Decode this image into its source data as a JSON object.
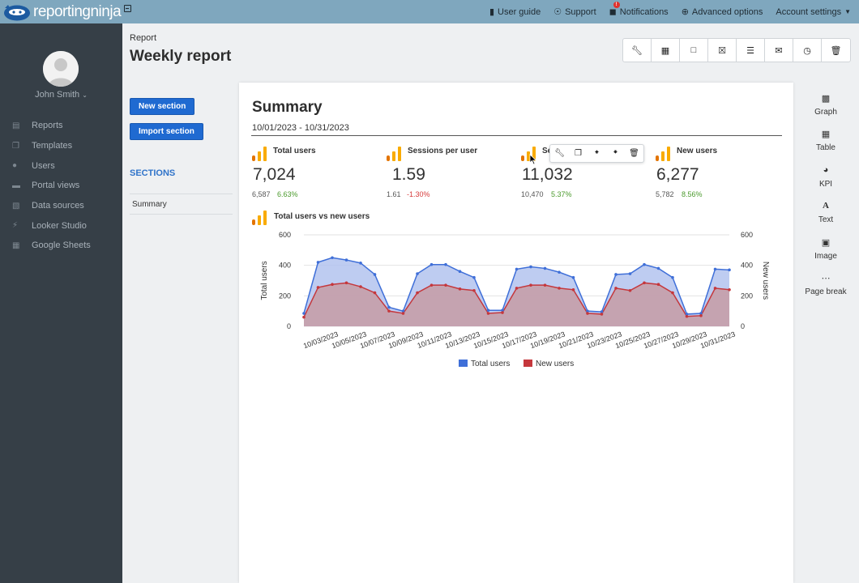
{
  "topbar": {
    "logo_text": "reportingninja",
    "nav": [
      {
        "icon": "book-icon",
        "label": "User guide"
      },
      {
        "icon": "lifebuoy-icon",
        "label": "Support"
      },
      {
        "icon": "bell-icon",
        "label": "Notifications",
        "badge": "!"
      },
      {
        "icon": "plus-circle-icon",
        "label": "Advanced options"
      },
      {
        "icon": "",
        "label": "Account settings"
      }
    ]
  },
  "sidebar": {
    "username": "John Smith",
    "items": [
      {
        "icon": "file-icon",
        "label": "Reports"
      },
      {
        "icon": "copy-icon",
        "label": "Templates"
      },
      {
        "icon": "user-icon",
        "label": "Users"
      },
      {
        "icon": "folder-icon",
        "label": "Portal views"
      },
      {
        "icon": "database-icon",
        "label": "Data sources"
      },
      {
        "icon": "plug-icon",
        "label": "Looker Studio"
      },
      {
        "icon": "table-icon",
        "label": "Google Sheets"
      }
    ]
  },
  "header": {
    "breadcrumb": "Report",
    "title": "Weekly report",
    "toolbar_icons": [
      "wrench-icon",
      "calendar-icon",
      "pdf-icon",
      "excel-icon",
      "database-icon",
      "envelope-icon",
      "clock-icon",
      "trash-icon"
    ]
  },
  "left": {
    "new_section": "New section",
    "import_section": "Import section",
    "sections_label": "SECTIONS",
    "sections": [
      "Summary"
    ]
  },
  "summary": {
    "title": "Summary",
    "date_range": "10/01/2023 - 10/31/2023",
    "kpis": [
      {
        "label": "Total users",
        "value": "7,024",
        "previous": "6,587",
        "change": "6.63%",
        "trend": "up"
      },
      {
        "label": "Sessions per user",
        "value": "1.59",
        "previous": "1.61",
        "change": "-1.30%",
        "trend": "down"
      },
      {
        "label": "Se",
        "value": "11,032",
        "previous": "10,470",
        "change": "5.37%",
        "trend": "up"
      },
      {
        "label": "New users",
        "value": "6,277",
        "previous": "5,782",
        "change": "8.56%",
        "trend": "up"
      }
    ],
    "mini_toolbar": [
      "wrench-icon",
      "copy-icon",
      "arrow-up-icon",
      "arrow-down-icon",
      "trash-icon"
    ],
    "chart_title": "Total users vs new users"
  },
  "right_panel": [
    {
      "icon": "bar-chart-icon",
      "label": "Graph"
    },
    {
      "icon": "table-icon",
      "label": "Table"
    },
    {
      "icon": "gauge-icon",
      "label": "KPI"
    },
    {
      "icon": "text-icon",
      "label": "Text"
    },
    {
      "icon": "image-icon",
      "label": "Image"
    },
    {
      "icon": "ellipsis-icon",
      "label": "Page break"
    }
  ],
  "chart_data": {
    "type": "area",
    "title": "Total users vs new users",
    "ylabel": "Total users",
    "y2label": "New users",
    "ylim": [
      0,
      600
    ],
    "y2lim": [
      0,
      600
    ],
    "yticks": [
      0,
      200,
      400,
      600
    ],
    "grid": true,
    "legend": "bottom",
    "x": [
      "10/01/2023",
      "10/02/2023",
      "10/03/2023",
      "10/04/2023",
      "10/05/2023",
      "10/06/2023",
      "10/07/2023",
      "10/08/2023",
      "10/09/2023",
      "10/10/2023",
      "10/11/2023",
      "10/12/2023",
      "10/13/2023",
      "10/14/2023",
      "10/15/2023",
      "10/16/2023",
      "10/17/2023",
      "10/18/2023",
      "10/19/2023",
      "10/20/2023",
      "10/21/2023",
      "10/22/2023",
      "10/23/2023",
      "10/24/2023",
      "10/25/2023",
      "10/26/2023",
      "10/27/2023",
      "10/28/2023",
      "10/29/2023",
      "10/30/2023",
      "10/31/2023"
    ],
    "xtick_labels": [
      "10/03/2023",
      "10/05/2023",
      "10/07/2023",
      "10/09/2023",
      "10/11/2023",
      "10/13/2023",
      "10/15/2023",
      "10/17/2023",
      "10/19/2023",
      "10/21/2023",
      "10/23/2023",
      "10/25/2023",
      "10/27/2023",
      "10/29/2023",
      "10/31/2023"
    ],
    "series": [
      {
        "name": "Total users",
        "color": "#3f6fd8",
        "fill": "#b3c3ee",
        "values": [
          85,
          420,
          450,
          435,
          415,
          340,
          125,
          100,
          345,
          405,
          405,
          360,
          320,
          105,
          105,
          375,
          390,
          380,
          355,
          320,
          100,
          95,
          340,
          345,
          405,
          380,
          320,
          80,
          85,
          375,
          370
        ]
      },
      {
        "name": "New users",
        "color": "#c5373c",
        "fill": "#c79ba5",
        "values": [
          60,
          255,
          275,
          285,
          260,
          220,
          100,
          85,
          220,
          270,
          270,
          245,
          235,
          85,
          90,
          250,
          270,
          270,
          250,
          240,
          85,
          80,
          250,
          235,
          285,
          275,
          220,
          65,
          70,
          250,
          240
        ]
      }
    ]
  }
}
